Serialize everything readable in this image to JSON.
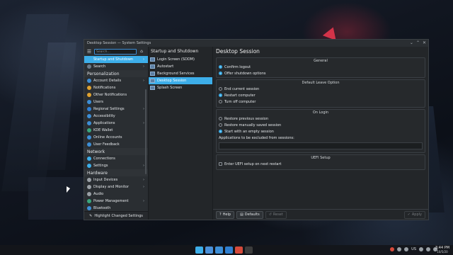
{
  "window": {
    "title": "Desktop Session — System Settings"
  },
  "sidebar": {
    "search_placeholder": "Search...",
    "items": [
      {
        "label": "Startup and Shutdown",
        "color": "#3daee9",
        "selected": true,
        "arrow": true
      },
      {
        "label": "Search",
        "color": "#6c7a89",
        "arrow": true
      },
      {
        "category": "Personalization"
      },
      {
        "label": "Account Details",
        "color": "#3d8ed6",
        "arrow": true
      },
      {
        "label": "Notifications",
        "color": "#e0a230"
      },
      {
        "label": "Other Notifications",
        "color": "#e0a230"
      },
      {
        "label": "Users",
        "color": "#3d8ed6"
      },
      {
        "label": "Regional Settings",
        "color": "#2e7fd6",
        "arrow": true
      },
      {
        "label": "Accessibility",
        "color": "#3d8ed6"
      },
      {
        "label": "Applications",
        "color": "#3d8ed6",
        "arrow": true
      },
      {
        "label": "KDE Wallet",
        "color": "#3aa57d"
      },
      {
        "label": "Online Accounts",
        "color": "#3d8ed6"
      },
      {
        "label": "User Feedback",
        "color": "#3d8ed6"
      },
      {
        "category": "Network"
      },
      {
        "label": "Connections",
        "color": "#3daee9"
      },
      {
        "label": "Settings",
        "color": "#3daee9",
        "arrow": true
      },
      {
        "category": "Hardware"
      },
      {
        "label": "Input Devices",
        "color": "#9aa0a6",
        "arrow": true
      },
      {
        "label": "Display and Monitor",
        "color": "#9aa0a6",
        "arrow": true
      },
      {
        "label": "Audio",
        "color": "#9aa0a6"
      },
      {
        "label": "Power Management",
        "color": "#3aa57d",
        "arrow": true
      },
      {
        "label": "Bluetooth",
        "color": "#3d8ed6"
      }
    ],
    "highlight_label": "Highlight Changed Settings"
  },
  "midpane": {
    "title": "Startup and Shutdown",
    "items": [
      {
        "label": "Login Screen (SDDM)"
      },
      {
        "label": "Autostart"
      },
      {
        "label": "Background Services"
      },
      {
        "label": "Desktop Session",
        "selected": true
      },
      {
        "label": "Splash Screen"
      }
    ]
  },
  "main": {
    "title": "Desktop Session",
    "general": {
      "title": "General",
      "options": [
        {
          "label": "Confirm logout",
          "checked": true
        },
        {
          "label": "Offer shutdown options",
          "checked": true
        }
      ]
    },
    "default_leave": {
      "title": "Default Leave Option",
      "options": [
        {
          "label": "End current session",
          "checked": false
        },
        {
          "label": "Restart computer",
          "checked": true
        },
        {
          "label": "Turn off computer",
          "checked": false
        }
      ]
    },
    "on_login": {
      "title": "On Login",
      "options": [
        {
          "label": "Restore previous session",
          "checked": false
        },
        {
          "label": "Restore manually saved session",
          "checked": false
        },
        {
          "label": "Start with an empty session",
          "checked": true
        }
      ],
      "exclude_label": "Applications to be excluded from sessions:",
      "exclude_value": ""
    },
    "uefi": {
      "title": "UEFI Setup",
      "option": {
        "label": "Enter UEFI setup on next restart",
        "checked": false
      }
    }
  },
  "footer": {
    "help": "Help",
    "defaults": "Defaults",
    "reset": "Reset",
    "apply": "Apply"
  },
  "taskbar": {
    "keyboard_layout": "US",
    "time": "3:44 PM",
    "date": "10/5/20",
    "apps": [
      {
        "name": "desktop-pager",
        "color": "#3daee9"
      },
      {
        "name": "system-settings",
        "color": "#4a90d9"
      },
      {
        "name": "discover",
        "color": "#3d8ed6"
      },
      {
        "name": "file-manager",
        "color": "#2f7fd0"
      },
      {
        "name": "chrome",
        "color": "#d64a3b"
      },
      {
        "name": "obs",
        "color": "#3c3c3c"
      }
    ]
  }
}
